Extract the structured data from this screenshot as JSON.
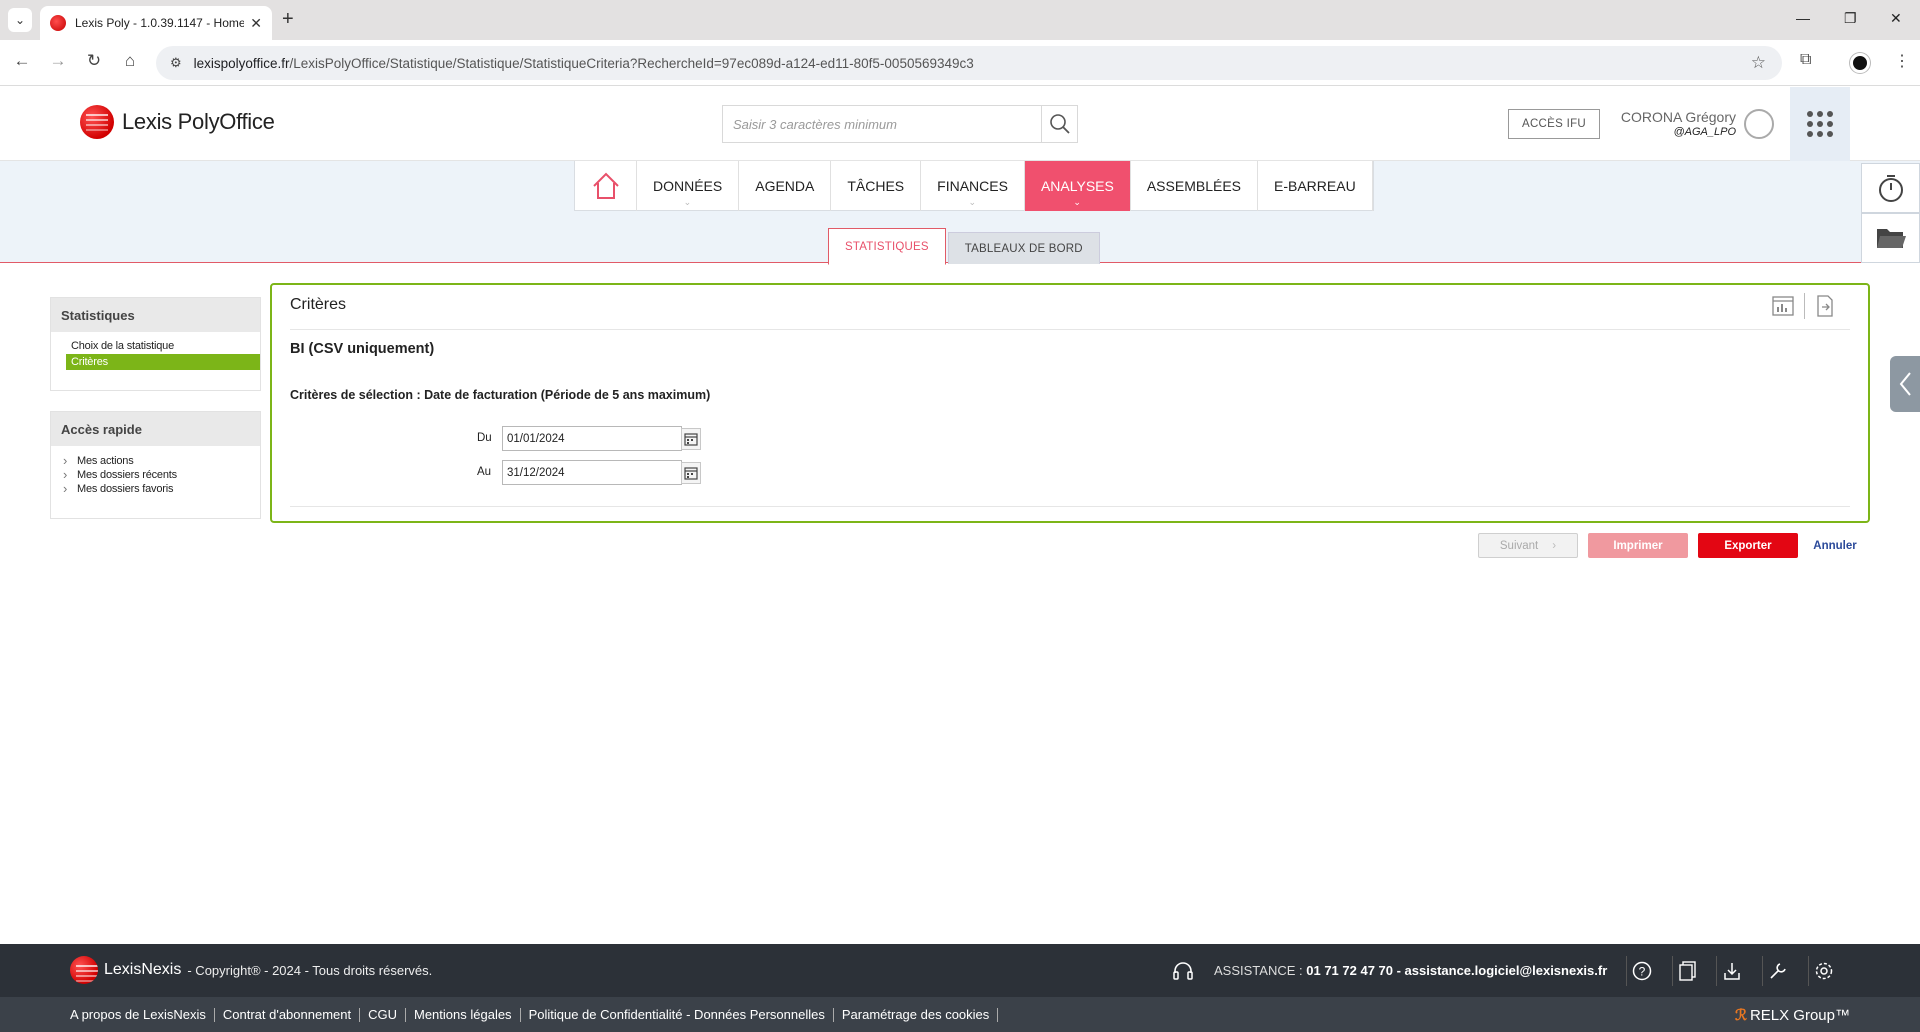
{
  "browser": {
    "tab_title": "Lexis Poly - 1.0.39.1147 - Home",
    "url_host": "lexispolyoffice.fr",
    "url_path": "/LexisPolyOffice/Statistique/Statistique/StatistiqueCriteria?RechercheId=97ec089d-a124-ed11-80f5-0050569349c3"
  },
  "header": {
    "logo_text": "Lexis PolyOffice",
    "search_placeholder": "Saisir 3 caractères minimum",
    "acces_ifu": "ACCÈS IFU",
    "user_name": "CORONA Grégory",
    "user_handle": "@AGA_LPO"
  },
  "nav": {
    "items": [
      "DONNÉES",
      "AGENDA",
      "TÂCHES",
      "FINANCES",
      "ANALYSES",
      "ASSEMBLÉES",
      "E-BARREAU"
    ],
    "active": "ANALYSES"
  },
  "subtabs": [
    "STATISTIQUES",
    "TABLEAUX DE BORD"
  ],
  "sidebar": {
    "stats_title": "Statistiques",
    "stats_items": [
      "Choix de la statistique",
      "Critères"
    ],
    "quick_title": "Accès rapide",
    "quick_items": [
      "Mes actions",
      "Mes dossiers récents",
      "Mes dossiers favoris"
    ]
  },
  "card": {
    "title": "Critères",
    "subtitle": "BI (CSV uniquement)",
    "criteria": "Critères de sélection : Date de facturation (Période de 5 ans maximum)",
    "du_label": "Du",
    "du_value": "01/01/2024",
    "au_label": "Au",
    "au_value": "31/12/2024"
  },
  "actions": {
    "suivant": "Suivant",
    "imprimer": "Imprimer",
    "exporter": "Exporter",
    "annuler": "Annuler"
  },
  "footer": {
    "brand": "LexisNexis",
    "copyright": "- Copyright® - 2024 - Tous droits réservés.",
    "assistance_label": "ASSISTANCE :",
    "assistance_value": "01 71 72 47 70 - assistance.logiciel@lexisnexis.fr",
    "links": [
      "A propos de LexisNexis",
      "Contrat d'abonnement",
      "CGU",
      "Mentions légales",
      "Politique de Confidentialité - Données Personnelles",
      "Paramétrage des cookies"
    ],
    "relx": "RELX Group™"
  },
  "colors": {
    "accent_red": "#e30613",
    "nav_active": "#f0506e",
    "green_border": "#7cb518",
    "footer_dark": "#2c3138"
  },
  "icons": [
    "search-icon",
    "home-icon",
    "timer-icon",
    "folder-icon",
    "calendar-icon",
    "headset-icon",
    "help-icon",
    "document-icon",
    "download-icon",
    "wrench-icon",
    "gear-icon"
  ]
}
